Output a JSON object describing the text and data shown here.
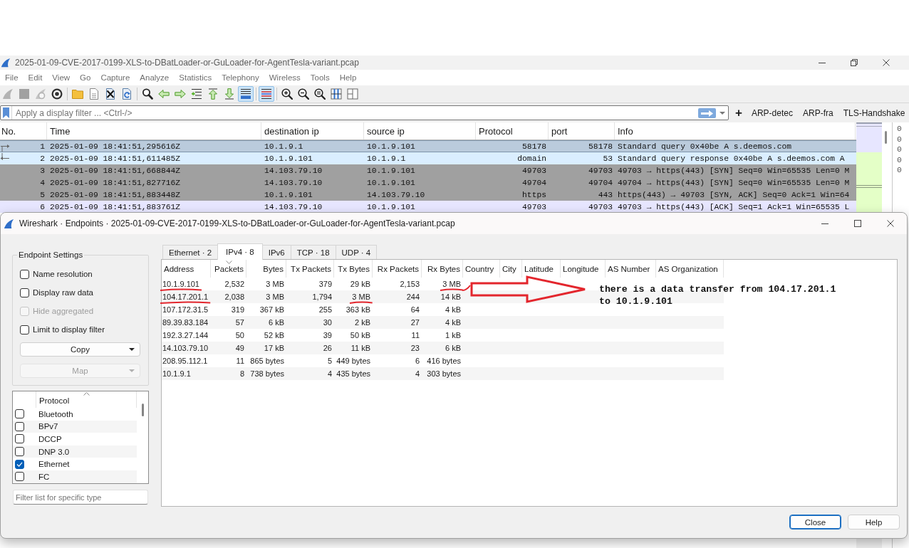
{
  "main_window": {
    "title": "2025-01-09-CVE-2017-0199-XLS-to-DBatLoader-or-GuLoader-for-AgentTesla-variant.pcap",
    "menu": [
      "File",
      "Edit",
      "View",
      "Go",
      "Capture",
      "Analyze",
      "Statistics",
      "Telephony",
      "Wireless",
      "Tools",
      "Help"
    ],
    "toolbar": [
      {
        "buttons": [
          {
            "kind": "start",
            "disabled": true,
            "pressed": false
          },
          {
            "kind": "stop",
            "disabled": true,
            "pressed": false
          },
          {
            "kind": "restart",
            "disabled": true,
            "pressed": false
          },
          {
            "kind": "options",
            "disabled": false,
            "pressed": false
          }
        ]
      },
      {
        "buttons": [
          {
            "kind": "open",
            "disabled": false,
            "pressed": false
          },
          {
            "kind": "save",
            "disabled": false,
            "pressed": false
          },
          {
            "kind": "close",
            "disabled": false,
            "pressed": false
          },
          {
            "kind": "reload",
            "disabled": false,
            "pressed": false
          }
        ]
      },
      {
        "buttons": [
          {
            "kind": "find",
            "disabled": false,
            "pressed": false
          },
          {
            "kind": "back",
            "disabled": false,
            "pressed": false
          },
          {
            "kind": "forward",
            "disabled": false,
            "pressed": false
          },
          {
            "kind": "goto",
            "disabled": false,
            "pressed": false
          },
          {
            "kind": "first",
            "disabled": false,
            "pressed": false
          },
          {
            "kind": "last",
            "disabled": false,
            "pressed": false
          },
          {
            "kind": "autoscroll",
            "disabled": false,
            "pressed": true
          }
        ]
      },
      {
        "buttons": [
          {
            "kind": "colorize",
            "disabled": false,
            "pressed": true
          }
        ]
      },
      {
        "buttons": [
          {
            "kind": "zoom-in",
            "disabled": false,
            "pressed": false
          },
          {
            "kind": "zoom-out",
            "disabled": false,
            "pressed": false
          },
          {
            "kind": "zoom-reset",
            "disabled": false,
            "pressed": false
          },
          {
            "kind": "resize-columns",
            "disabled": false,
            "pressed": false
          },
          {
            "kind": "layout",
            "disabled": false,
            "pressed": false
          }
        ]
      }
    ],
    "filter_bar": {
      "placeholder": "Apply a display filter ... <Ctrl-/>",
      "add_button": "+",
      "saved_filters": [
        "ARP-detec",
        "ARP-fra",
        "TLS-Handshake"
      ]
    },
    "packet_list": {
      "columns": [
        "No.",
        "Time",
        "destination ip",
        "source ip",
        "Protocol",
        "port",
        "Info"
      ],
      "rows": [
        {
          "kind": "request",
          "cells": [
            "1",
            "2025-01-09 18:41:51,295616Z",
            "10.1.9.1",
            "10.1.9.101",
            "58178",
            "58178",
            "Standard query 0x40be A s.deemos.com"
          ],
          "color": "#bacbdc",
          "selected": true
        },
        {
          "kind": "response",
          "cells": [
            "2",
            "2025-01-09 18:41:51,611485Z",
            "10.1.9.101",
            "10.1.9.1",
            "domain",
            "53",
            "Standard query response 0x40be A s.deemos.com A"
          ],
          "color": "#daeeff",
          "selected": false
        },
        {
          "kind": "plain",
          "cells": [
            "3",
            "2025-01-09 18:41:51,668844Z",
            "14.103.79.10",
            "10.1.9.101",
            "49703",
            "49703",
            "49703 → https(443) [SYN] Seq=0 Win=65535 Len=0 M"
          ],
          "color": "#a0a0a0",
          "selected": false
        },
        {
          "kind": "plain",
          "cells": [
            "4",
            "2025-01-09 18:41:51,827716Z",
            "14.103.79.10",
            "10.1.9.101",
            "49704",
            "49704",
            "49704 → https(443) [SYN] Seq=0 Win=65535 Len=0 M"
          ],
          "color": "#a0a0a0",
          "selected": false
        },
        {
          "kind": "plain",
          "cells": [
            "5",
            "2025-01-09 18:41:51,883448Z",
            "10.1.9.101",
            "14.103.79.10",
            "https",
            "443",
            "https(443) → 49703 [SYN, ACK] Seq=0 Ack=1 Win=64"
          ],
          "color": "#a0a0a0",
          "selected": false
        },
        {
          "kind": "plain",
          "cells": [
            "6",
            "2025-01-09 18:41:51,883761Z",
            "14.103.79.10",
            "10.1.9.101",
            "49703",
            "49703",
            "49703 → https(443) [ACK] Seq=1 Ack=1 Win=65535 L"
          ],
          "color": "#e7e6ff",
          "selected": false
        }
      ]
    },
    "bytes_pane": [
      "0",
      "0",
      "0",
      "0",
      "0"
    ]
  },
  "endpoints_dialog": {
    "title": "Wireshark · Endpoints · 2025-01-09-CVE-2017-0199-XLS-to-DBatLoader-or-GuLoader-for-AgentTesla-variant.pcap",
    "settings": {
      "title": "Endpoint Settings",
      "options": [
        {
          "label": "Name resolution",
          "checked": false,
          "disabled": false
        },
        {
          "label": "Display raw data",
          "checked": false,
          "disabled": false
        },
        {
          "label": "Hide aggregated",
          "checked": false,
          "disabled": true
        },
        {
          "label": "Limit to display filter",
          "checked": false,
          "disabled": false
        }
      ],
      "buttons": [
        {
          "label": "Copy",
          "disabled": false
        },
        {
          "label": "Map",
          "disabled": true
        }
      ]
    },
    "protocols": {
      "column": "Protocol",
      "sorted": true,
      "items": [
        {
          "label": "Bluetooth",
          "checked": false
        },
        {
          "label": "BPv7",
          "checked": false
        },
        {
          "label": "DCCP",
          "checked": false
        },
        {
          "label": "DNP 3.0",
          "checked": false
        },
        {
          "label": "Ethernet",
          "checked": true
        },
        {
          "label": "FC",
          "checked": false
        }
      ]
    },
    "type_filter": {
      "placeholder": "Filter list for specific type"
    },
    "tabs": [
      {
        "label": "Ethernet · 2",
        "selected": false
      },
      {
        "label": "IPv4 · 8",
        "selected": true
      },
      {
        "label": "IPv6",
        "selected": false
      },
      {
        "label": "TCP · 18",
        "selected": false
      },
      {
        "label": "UDP · 4",
        "selected": false
      }
    ],
    "table": {
      "descending": true,
      "columns": [
        {
          "label": "Address",
          "sorted": false
        },
        {
          "label": "Packets",
          "sorted": true
        },
        {
          "label": "Bytes",
          "sorted": false
        },
        {
          "label": "Tx Packets",
          "sorted": false
        },
        {
          "label": "Tx Bytes",
          "sorted": false
        },
        {
          "label": "Rx Packets",
          "sorted": false
        },
        {
          "label": "Rx Bytes",
          "sorted": false
        },
        {
          "label": "Country",
          "sorted": false
        },
        {
          "label": "City",
          "sorted": false
        },
        {
          "label": "Latitude",
          "sorted": false
        },
        {
          "label": "Longitude",
          "sorted": false
        },
        {
          "label": "AS Number",
          "sorted": false
        },
        {
          "label": "AS Organization",
          "sorted": false
        }
      ],
      "rows": [
        {
          "cells": [
            "10.1.9.101",
            "2,532",
            "3 MB",
            "379",
            "29 kB",
            "2,153",
            "3 MB"
          ],
          "underlined": [
            true,
            false,
            false,
            false,
            false,
            false,
            true
          ]
        },
        {
          "cells": [
            "104.17.201.1",
            "2,038",
            "3 MB",
            "1,794",
            "3 MB",
            "244",
            "14 kB"
          ],
          "underlined": [
            true,
            false,
            false,
            false,
            true,
            false,
            false
          ]
        },
        {
          "cells": [
            "107.172.31.5",
            "319",
            "367 kB",
            "255",
            "363 kB",
            "64",
            "4 kB"
          ],
          "underlined": [
            false,
            false,
            false,
            false,
            false,
            false,
            false
          ]
        },
        {
          "cells": [
            "89.39.83.184",
            "57",
            "6 kB",
            "30",
            "2 kB",
            "27",
            "4 kB"
          ],
          "underlined": [
            false,
            false,
            false,
            false,
            false,
            false,
            false
          ]
        },
        {
          "cells": [
            "192.3.27.144",
            "50",
            "52 kB",
            "39",
            "50 kB",
            "11",
            "1 kB"
          ],
          "underlined": [
            false,
            false,
            false,
            false,
            false,
            false,
            false
          ]
        },
        {
          "cells": [
            "14.103.79.10",
            "49",
            "17 kB",
            "26",
            "11 kB",
            "23",
            "6 kB"
          ],
          "underlined": [
            false,
            false,
            false,
            false,
            false,
            false,
            false
          ]
        },
        {
          "cells": [
            "208.95.112.1",
            "11",
            "865 bytes",
            "5",
            "449 bytes",
            "6",
            "416 bytes"
          ],
          "underlined": [
            false,
            false,
            false,
            false,
            false,
            false,
            false
          ]
        },
        {
          "cells": [
            "10.1.9.1",
            "8",
            "738 bytes",
            "4",
            "435 bytes",
            "4",
            "303 bytes"
          ],
          "underlined": [
            false,
            false,
            false,
            false,
            false,
            false,
            false
          ]
        }
      ]
    },
    "annotation": {
      "text": "there is a data transfer from 104.17.201.1 to 10.1.9.101"
    },
    "buttons": [
      {
        "label": "Close",
        "default": true
      },
      {
        "label": "Help",
        "default": false
      }
    ]
  }
}
